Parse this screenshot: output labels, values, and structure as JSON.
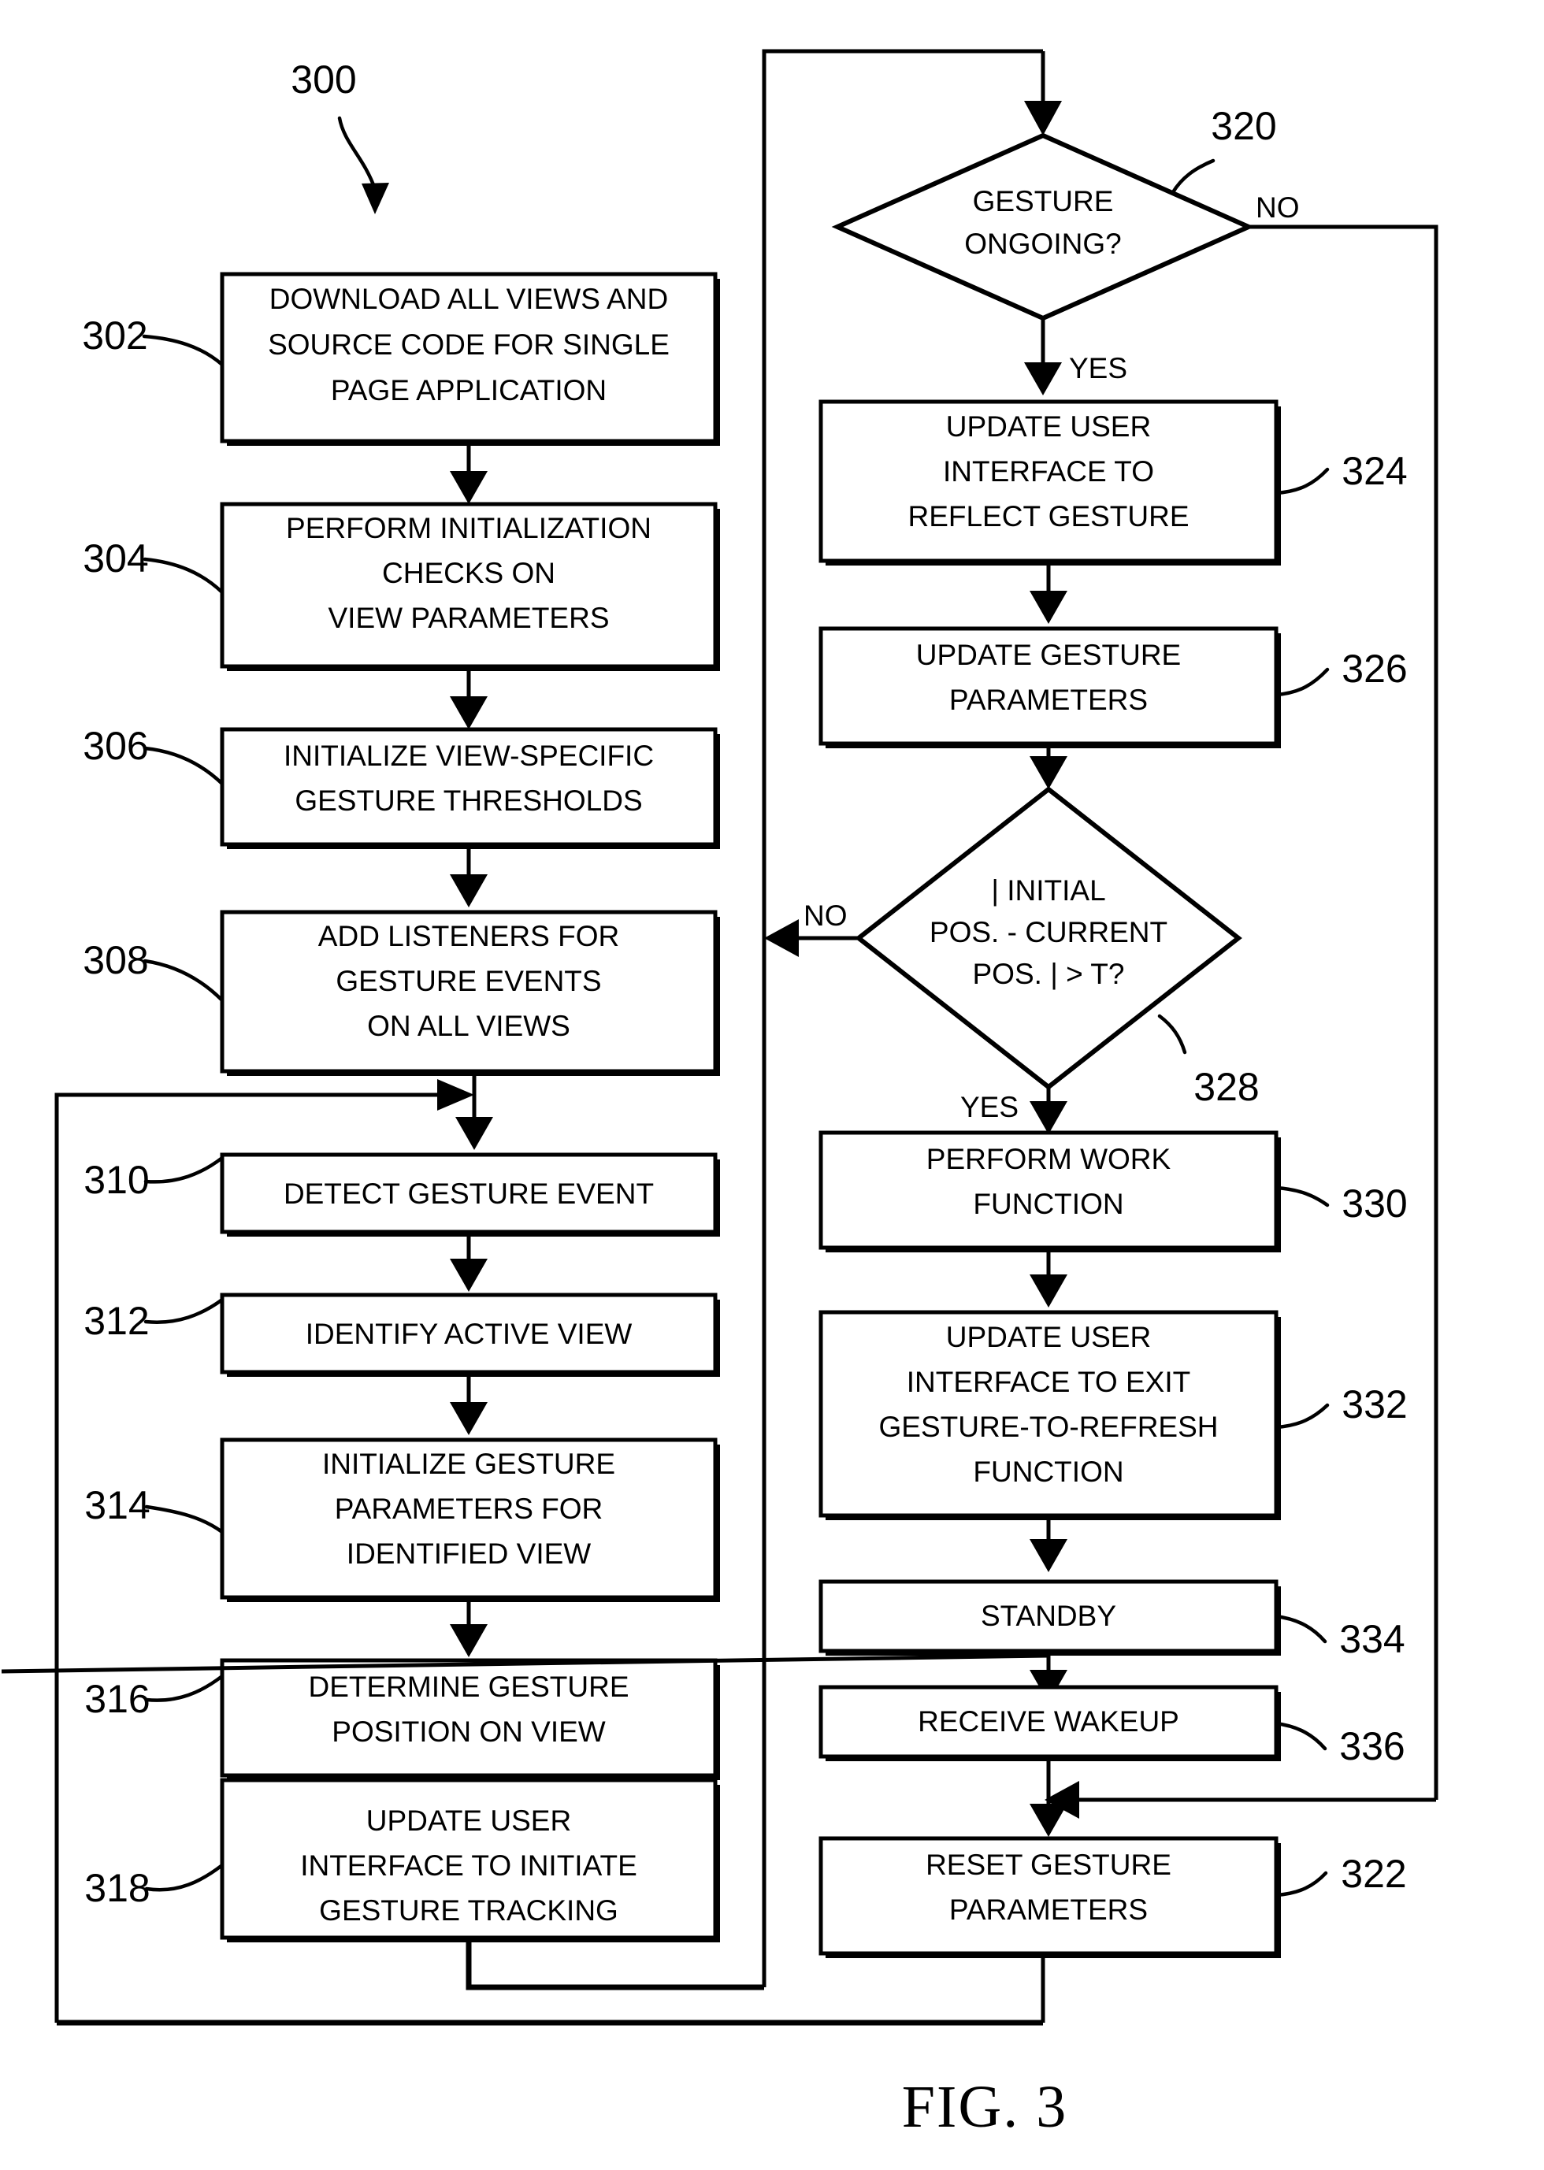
{
  "figure": {
    "caption": "FIG. 3",
    "diagram_number": "300"
  },
  "nodes": {
    "n302": {
      "ref": "302",
      "type": "process",
      "lines": [
        "DOWNLOAD ALL VIEWS AND",
        "SOURCE CODE FOR SINGLE",
        "PAGE APPLICATION"
      ]
    },
    "n304": {
      "ref": "304",
      "type": "process",
      "lines": [
        "PERFORM INITIALIZATION",
        "CHECKS ON",
        "VIEW PARAMETERS"
      ]
    },
    "n306": {
      "ref": "306",
      "type": "process",
      "lines": [
        "INITIALIZE VIEW-SPECIFIC",
        "GESTURE THRESHOLDS"
      ]
    },
    "n308": {
      "ref": "308",
      "type": "process",
      "lines": [
        "ADD LISTENERS FOR",
        "GESTURE EVENTS",
        "ON ALL VIEWS"
      ]
    },
    "n310": {
      "ref": "310",
      "type": "process",
      "lines": [
        "DETECT GESTURE EVENT"
      ]
    },
    "n312": {
      "ref": "312",
      "type": "process",
      "lines": [
        "IDENTIFY ACTIVE VIEW"
      ]
    },
    "n314": {
      "ref": "314",
      "type": "process",
      "lines": [
        "INITIALIZE GESTURE",
        "PARAMETERS FOR",
        "IDENTIFIED VIEW"
      ]
    },
    "n316": {
      "ref": "316",
      "type": "process",
      "lines": [
        "DETERMINE GESTURE",
        "POSITION ON VIEW"
      ]
    },
    "n318": {
      "ref": "318",
      "type": "process",
      "lines": [
        "UPDATE USER",
        "INTERFACE TO INITIATE",
        "GESTURE TRACKING"
      ]
    },
    "n320": {
      "ref": "320",
      "type": "decision",
      "lines": [
        "GESTURE",
        "ONGOING?"
      ]
    },
    "n324": {
      "ref": "324",
      "type": "process",
      "lines": [
        "UPDATE USER",
        "INTERFACE TO",
        "REFLECT GESTURE"
      ]
    },
    "n326": {
      "ref": "326",
      "type": "process",
      "lines": [
        "UPDATE GESTURE",
        "PARAMETERS"
      ]
    },
    "n328": {
      "ref": "328",
      "type": "decision",
      "lines": [
        "| INITIAL",
        "POS. - CURRENT",
        "POS. | > T?"
      ]
    },
    "n330": {
      "ref": "330",
      "type": "process",
      "lines": [
        "PERFORM WORK",
        "FUNCTION"
      ]
    },
    "n332": {
      "ref": "332",
      "type": "process",
      "lines": [
        "UPDATE USER",
        "INTERFACE TO EXIT",
        "GESTURE-TO-REFRESH",
        "FUNCTION"
      ]
    },
    "n334": {
      "ref": "334",
      "type": "process",
      "lines": [
        "STANDBY"
      ]
    },
    "n336": {
      "ref": "336",
      "type": "process",
      "lines": [
        "RECEIVE WAKEUP"
      ]
    },
    "n322": {
      "ref": "322",
      "type": "process",
      "lines": [
        "RESET GESTURE",
        "PARAMETERS"
      ]
    }
  },
  "branch_labels": {
    "d320_no": "NO",
    "d320_yes": "YES",
    "d328_no": "NO",
    "d328_yes": "YES"
  },
  "colors": {
    "stroke": "#000000",
    "fill": "#ffffff",
    "text": "#000000"
  }
}
